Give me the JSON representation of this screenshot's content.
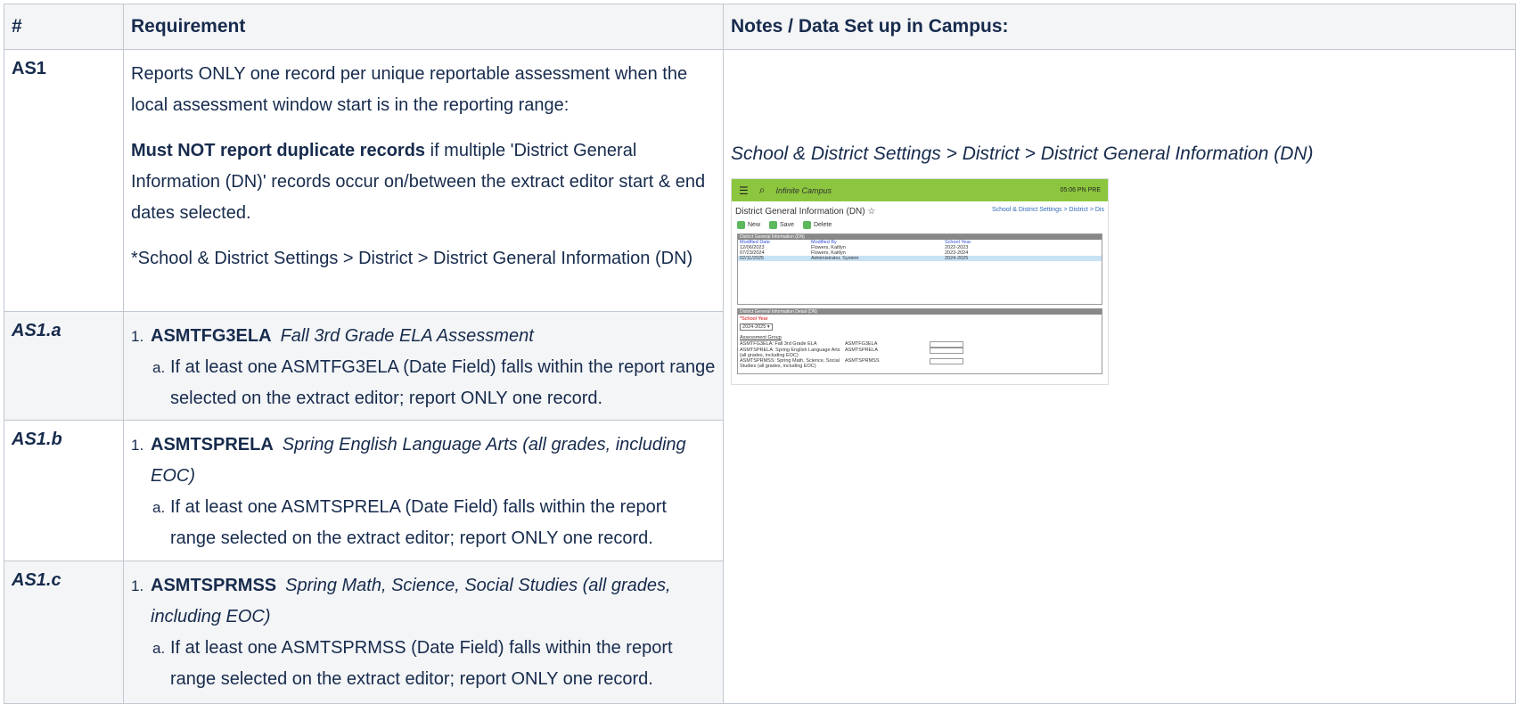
{
  "headers": [
    "#",
    "Requirement",
    "Notes / Data Set up in Campus:"
  ],
  "row_as1": {
    "id": "AS1",
    "p1": "Reports ONLY one record per unique reportable assessment when the local assessment window start is in the reporting range:",
    "p2_bold": "Must NOT report duplicate records",
    "p2_rest": " if multiple 'District General Information (DN)' records occur on/between the extract editor start & end dates selected.",
    "p3": "*School & District Settings > District > District General Information (DN)"
  },
  "sub_rows": [
    {
      "id": "AS1.a",
      "num1": "1.",
      "code": "ASMTFG3ELA",
      "desc": "Fall 3rd Grade ELA Assessment",
      "num2": "a.",
      "detail": "If at least one ASMTFG3ELA (Date Field) falls within the report range selected on the extract editor; report ONLY one record."
    },
    {
      "id": "AS1.b",
      "num1": "1.",
      "code": "ASMTSPRELA",
      "desc": "Spring English Language Arts (all grades, including EOC)",
      "num2": "a.",
      "detail": "If at least one ASMTSPRELA (Date Field) falls within the report range selected on the extract editor; report ONLY one record."
    },
    {
      "id": "AS1.c",
      "num1": "1.",
      "code": "ASMTSPRMSS",
      "desc": "Spring Math, Science, Social Studies (all grades, including EOC)",
      "num2": "a.",
      "detail": "If at least one ASMTSPRMSS (Date Field) falls within the report range selected on the extract editor; report ONLY one record."
    }
  ],
  "notes": {
    "caption": "School & District Settings > District > District General Information (DN)",
    "shot": {
      "logo": "Infinite Campus",
      "clock": "05:06 PN PRE",
      "title": "District General Information (DN) ☆",
      "breadcrumb": "School & District Settings  >  District  >  Dis",
      "buttons": [
        "New",
        "Save",
        "Delete"
      ],
      "grid_title": "District General Information (DN)",
      "grid_headers": [
        "Modified Date",
        "Modified By",
        "School Year"
      ],
      "grid_rows": [
        [
          "12/06/2023",
          "Flowers, Kaitlyn",
          "2022-2023"
        ],
        [
          "07/23/2024",
          "Flowers, Kaitlyn",
          "2023-2024"
        ],
        [
          "02/11/2025",
          "Administrator, System",
          "2024-2025"
        ]
      ],
      "detail_title": "District General Information Detail (DN)",
      "school_year_label": "*School Year",
      "school_year_value": "2024-2025 ▾",
      "assessment_group": "Assessment Group",
      "assessments": [
        [
          "ASMTFG3ELA: Fall 3rd Grade ELA",
          "ASMTFG3ELA"
        ],
        [
          "ASMTSPRELA: Spring English Language Arts (all grades, including EOC)",
          "ASMTSPRELA"
        ],
        [
          "ASMTSPRMSS: Spring Math, Science, Social Studies (all grades, including EOC)",
          "ASMTSPRMSS"
        ]
      ]
    }
  }
}
